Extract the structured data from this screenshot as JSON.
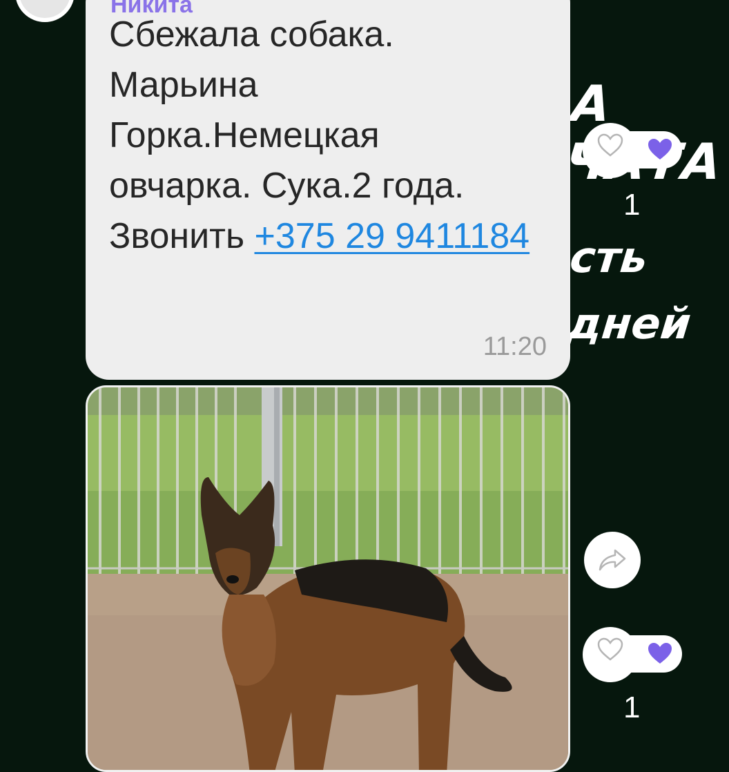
{
  "background_words": [
    "А ЧАТА",
    "сть",
    "дней"
  ],
  "message": {
    "sender": "Никита",
    "text_lines": [
      "Сбежала собака.",
      "Марьина",
      "Горка.Немецкая",
      "овчарка. Сука.2 года."
    ],
    "call_prefix": "Звонить ",
    "phone": "+375 29 9411184",
    "time": "11:20"
  },
  "photo": {
    "subject": "German shepherd dog standing on sand in front of a fence"
  },
  "reactions": [
    {
      "count": "1",
      "icons": [
        "heart-outline-icon",
        "heart-filled-icon"
      ]
    },
    {
      "count": "1",
      "icons": [
        "heart-outline-icon",
        "heart-filled-icon"
      ]
    }
  ],
  "share": {
    "icon": "share-arrow-icon"
  },
  "colors": {
    "background": "#06170d",
    "bubble": "#eeeeee",
    "sender": "#8a73e8",
    "link": "#1f87e0",
    "reaction_heart": "#7b61e8"
  }
}
